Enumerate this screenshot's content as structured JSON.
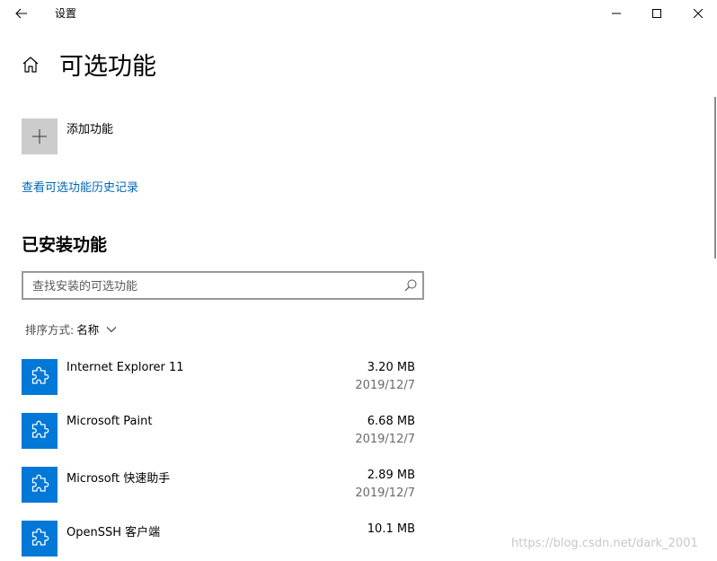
{
  "window": {
    "title": "设置"
  },
  "page": {
    "title": "可选功能"
  },
  "add_feature": {
    "label": "添加功能"
  },
  "history_link": {
    "label": "查看可选功能历史记录"
  },
  "installed": {
    "title": "已安装功能",
    "search_placeholder": "查找安装的可选功能",
    "sort_label": "排序方式:",
    "sort_value": "名称"
  },
  "features": [
    {
      "name": "Internet Explorer 11",
      "size": "3.20 MB",
      "date": "2019/12/7"
    },
    {
      "name": "Microsoft Paint",
      "size": "6.68 MB",
      "date": "2019/12/7"
    },
    {
      "name": "Microsoft 快速助手",
      "size": "2.89 MB",
      "date": "2019/12/7"
    },
    {
      "name": "OpenSSH 客户端",
      "size": "10.1 MB",
      "date": ""
    }
  ],
  "watermark": "https://blog.csdn.net/dark_2001",
  "colors": {
    "accent": "#0078d7",
    "link": "#0067b8",
    "add_tile": "#cccccc"
  },
  "icons": {
    "back": "back-arrow-icon",
    "minimize": "minimize-icon",
    "maximize": "maximize-icon",
    "close": "close-icon",
    "home": "home-icon",
    "add": "plus-icon",
    "search": "search-icon",
    "sort": "chevron-down-icon",
    "feature": "puzzle-piece-icon"
  }
}
